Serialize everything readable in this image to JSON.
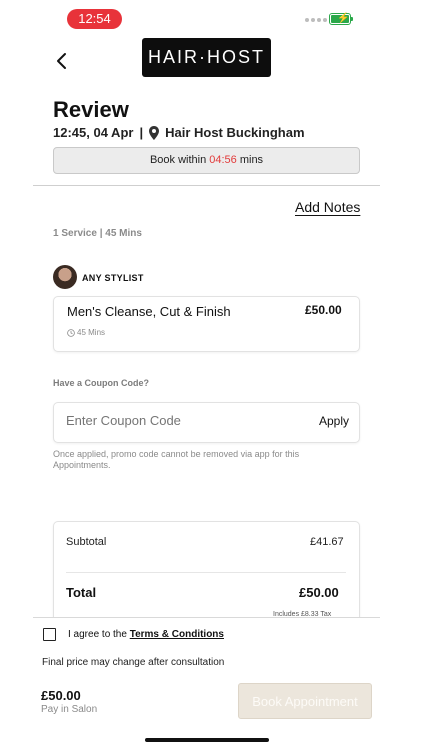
{
  "status_bar": {
    "time": "12:54"
  },
  "header": {
    "logo_text": "HAIR·HOST",
    "back_icon": "chevron-left-icon"
  },
  "review": {
    "title": "Review",
    "datetime": "12:45, 04 Apr",
    "separator": "|",
    "location": "Hair Host Buckingham",
    "timer_prefix": "Book within ",
    "timer_value": "04:56",
    "timer_suffix": " mins",
    "timer_color": "#e23b3b"
  },
  "notes": {
    "add_notes_label": "Add Notes"
  },
  "summary": {
    "service_count": "1 Service | 45 Mins",
    "stylist": "ANY STYLIST",
    "service": {
      "name": "Men's Cleanse, Cut & Finish",
      "price": "£50.00",
      "duration": "45 Mins"
    }
  },
  "coupon": {
    "label": "Have a Coupon Code?",
    "placeholder": "Enter Coupon Code",
    "apply_label": "Apply",
    "note": "Once applied, promo code cannot be removed via app for this Appointments."
  },
  "totals": {
    "subtotal_label": "Subtotal",
    "subtotal_value": "£41.67",
    "total_label": "Total",
    "total_value": "£50.00",
    "tax_note": "Includes £8.33 Tax"
  },
  "footer": {
    "agree_prefix": "I agree to the ",
    "terms_label": "Terms & Conditions",
    "final_note": "Final price may change after consultation",
    "pay_amount": "£50.00",
    "pay_where": "Pay in Salon",
    "book_label": "Book Appointment"
  }
}
